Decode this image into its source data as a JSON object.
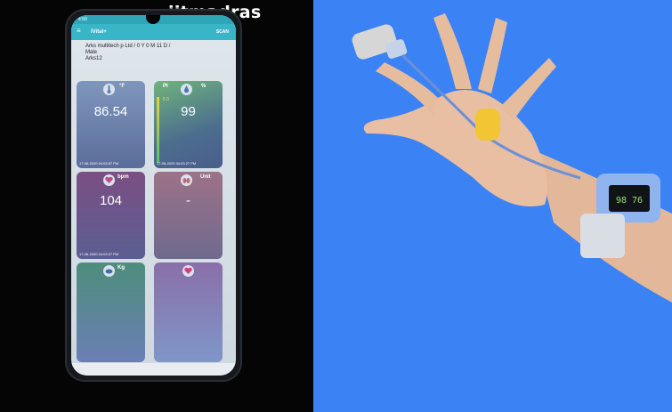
{
  "watermark": "iitmadras",
  "phone": {
    "status_time": "4:58",
    "app_title": "iVital+",
    "scan_label": "SCAN",
    "patient_line1": "Arks multitech p Ltd / 0 Y 0 M 11 D /",
    "patient_line2": "Male",
    "patient_line3": "Arks12",
    "cards": [
      {
        "unit": "°F",
        "value": "86.54",
        "timestamp": "17-06-2020 04:03:57 PM",
        "icon": "thermometer-icon"
      },
      {
        "unit": "%",
        "label": "PI",
        "pi_value": "5.0",
        "value": "99",
        "timestamp": "17-06-2020 04:03:27 PM",
        "icon": "drop-icon"
      },
      {
        "unit": "bpm",
        "value": "104",
        "timestamp": "17-06-2020 04:03:27 PM",
        "icon": "heart-icon"
      },
      {
        "unit": "Unit",
        "value": "-",
        "timestamp": "",
        "icon": "lungs-icon"
      },
      {
        "unit": "Kg",
        "value": "",
        "timestamp": "",
        "icon": "weight-icon"
      },
      {
        "unit": "",
        "value": "",
        "timestamp": "",
        "icon": "heart-icon"
      }
    ]
  },
  "device": {
    "display_value": "98 76"
  },
  "colors": {
    "background_blue": "#3b82f4",
    "appbar_teal": "#38b6c8"
  }
}
